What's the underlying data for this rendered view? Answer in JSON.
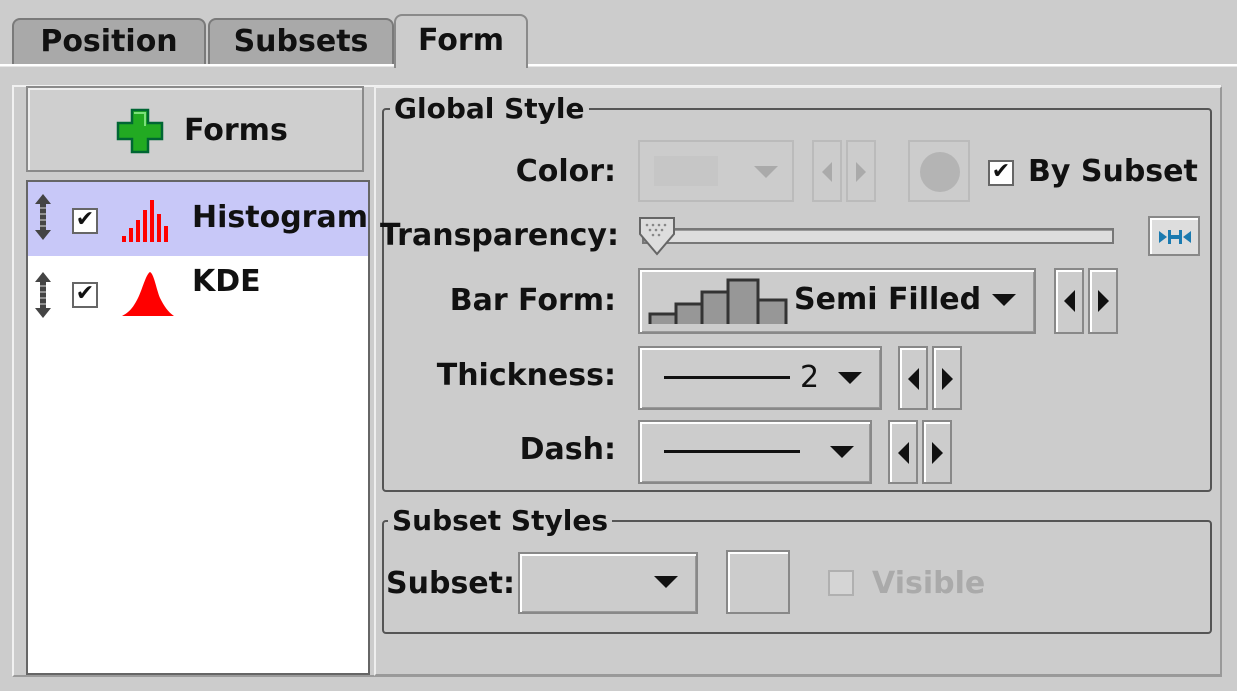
{
  "tabs": [
    {
      "label": "Position"
    },
    {
      "label": "Subsets"
    },
    {
      "label": "Form"
    }
  ],
  "left": {
    "forms_button_label": "Forms",
    "layers": [
      {
        "label": "Histogram",
        "checked": "✔",
        "selected": true
      },
      {
        "label": "KDE",
        "checked": "✔",
        "selected": false
      }
    ]
  },
  "global_style": {
    "title": "Global Style",
    "color_label": "Color:",
    "by_subset_label": "By Subset",
    "by_subset_check": "✔",
    "transparency_label": "Transparency:",
    "transparency_value": 0,
    "bar_form_label": "Bar Form:",
    "bar_form_value": "Semi Filled",
    "thickness_label": "Thickness:",
    "thickness_value": "2",
    "dash_label": "Dash:"
  },
  "subset_styles": {
    "title": "Subset Styles",
    "subset_label": "Subset:",
    "visible_label": "Visible"
  },
  "colors": {
    "selection": "#c8c8f8",
    "plot_red": "#ff0000",
    "add_green": "#22aa22",
    "lock_blue": "#1a7ab0"
  }
}
